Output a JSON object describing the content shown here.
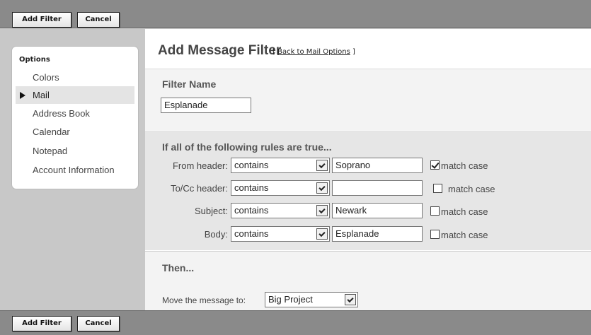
{
  "toolbar": {
    "add_filter_label": "Add Filter",
    "cancel_label": "Cancel"
  },
  "sidebar": {
    "title": "Options",
    "items": [
      {
        "label": "Colors",
        "active": false
      },
      {
        "label": "Mail",
        "active": true
      },
      {
        "label": "Address Book",
        "active": false
      },
      {
        "label": "Calendar",
        "active": false
      },
      {
        "label": "Notepad",
        "active": false
      },
      {
        "label": "Account Information",
        "active": false
      }
    ]
  },
  "main": {
    "title": "Add Message Filter",
    "back_prefix": "[ ",
    "back_link": "Back to Mail Options",
    "back_suffix": " ]",
    "filter_name_label": "Filter Name",
    "filter_name_value": "Esplanade",
    "rules_heading": "If all of the following rules are true...",
    "rules": [
      {
        "field": "From header:",
        "operator": "contains",
        "value": "Soprano",
        "match_case": true,
        "match_case_label": "match case"
      },
      {
        "field": "To/Cc header:",
        "operator": "contains",
        "value": "",
        "match_case": false,
        "match_case_label": "match case"
      },
      {
        "field": "Subject:",
        "operator": "contains",
        "value": "Newark",
        "match_case": false,
        "match_case_label": "match case"
      },
      {
        "field": "Body:",
        "operator": "contains",
        "value": "Esplanade",
        "match_case": false,
        "match_case_label": "match case"
      }
    ],
    "then_heading": "Then...",
    "move_label": "Move the message to:",
    "move_target": "Big Project"
  },
  "icons": {
    "active_item": "triangle-right-icon",
    "dropdown": "chevron-down-icon",
    "checked": "checkmark-icon"
  }
}
